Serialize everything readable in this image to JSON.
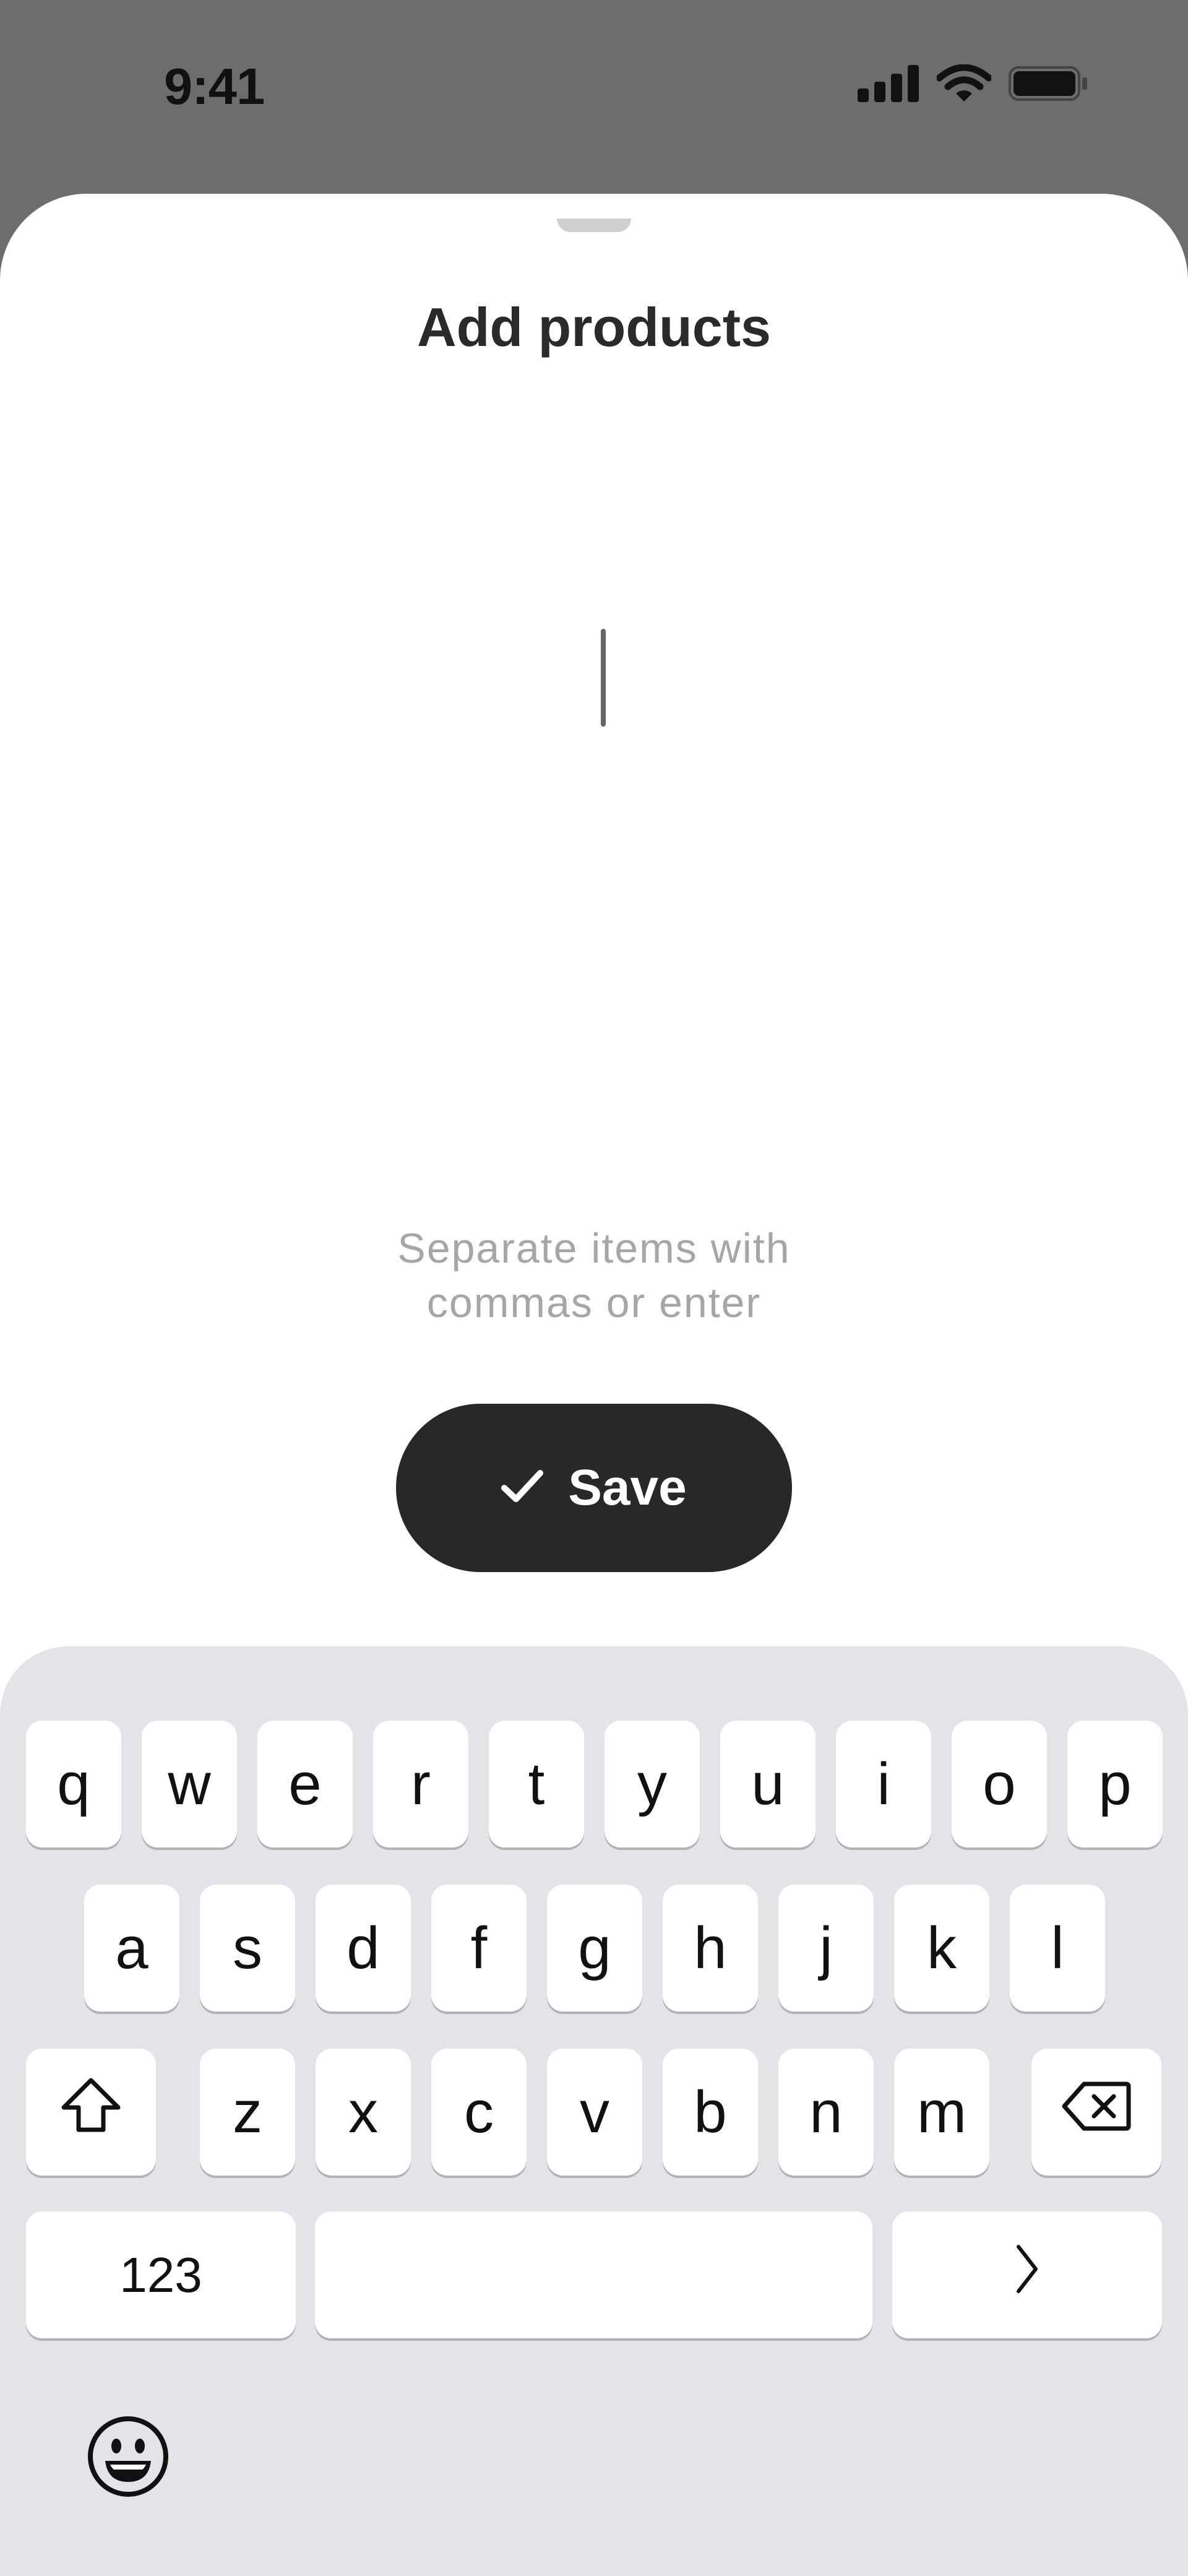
{
  "status_bar": {
    "time": "9:41"
  },
  "sheet": {
    "title": "Add products",
    "hint_line1": "Separate items with",
    "hint_line2": "commas or enter",
    "save_label": "Save"
  },
  "keyboard": {
    "row1": [
      "q",
      "w",
      "e",
      "r",
      "t",
      "y",
      "u",
      "i",
      "o",
      "p"
    ],
    "row2": [
      "a",
      "s",
      "d",
      "f",
      "g",
      "h",
      "j",
      "k",
      "l"
    ],
    "row3": [
      "z",
      "x",
      "c",
      "v",
      "b",
      "n",
      "m"
    ],
    "numbers_label": "123",
    "icons": [
      "shift-icon",
      "delete-icon",
      "next-icon",
      "emoji-icon"
    ]
  }
}
